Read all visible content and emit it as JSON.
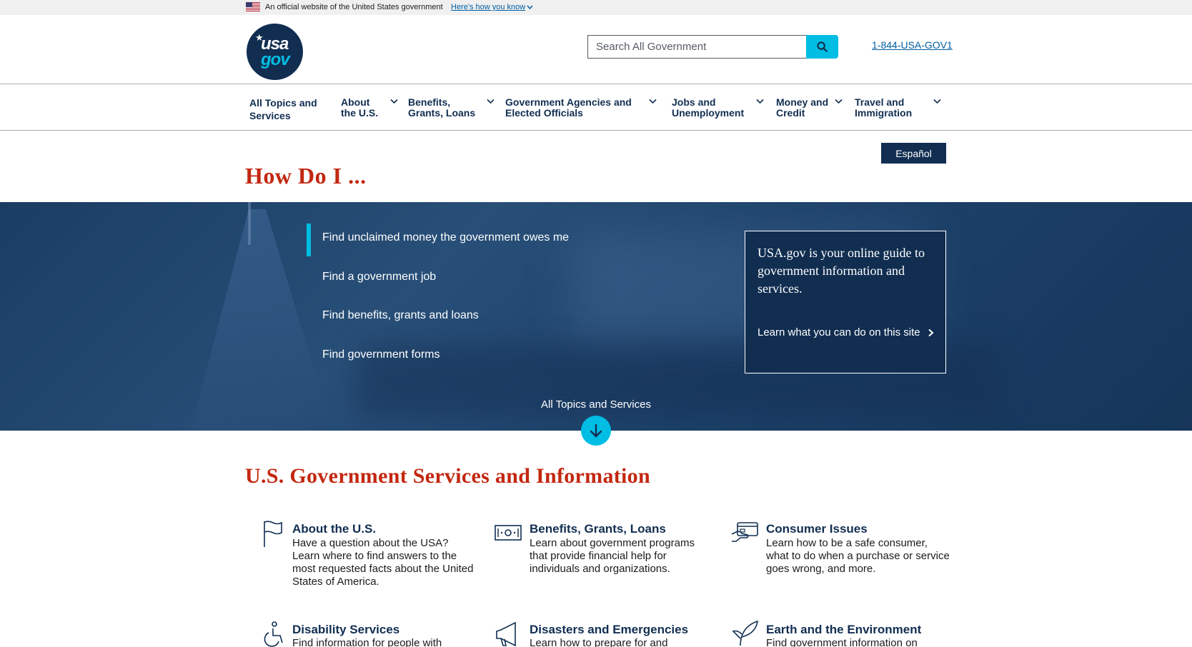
{
  "banner": {
    "official": "An official website of the United States government",
    "how_you_know": "Here's how you know"
  },
  "header": {
    "logo_top": "usa",
    "logo_bottom": "gov",
    "search_placeholder": "Search All Government",
    "phone": "1-844-USA-GOV1"
  },
  "nav": [
    {
      "line1": "All Topics and",
      "line2": "Services"
    },
    {
      "line1": "About",
      "line2": "the U.S."
    },
    {
      "line1": "Benefits,",
      "line2": "Grants, Loans"
    },
    {
      "line1": "Government Agencies and",
      "line2": "Elected Officials"
    },
    {
      "line1": "Jobs and",
      "line2": "Unemployment"
    },
    {
      "line1": "Money and",
      "line2": "Credit"
    },
    {
      "line1": "Travel and",
      "line2": "Immigration"
    }
  ],
  "language_button": "Español",
  "how_title": "How Do I ...",
  "quick_links": [
    "Find unclaimed money the government owes me",
    "Find a government job",
    "Find benefits, grants and loans",
    "Find government forms"
  ],
  "info_box": {
    "text": "USA.gov is your online guide to government information and services.",
    "learn": "Learn what you can do on this site"
  },
  "all_topics": "All Topics and Services",
  "services_title": "U.S. Government Services and Information",
  "cards": [
    {
      "icon": "flag-icon",
      "title": "About the U.S.",
      "desc": "Have a question about the USA? Learn where to find answers to the most requested facts about the United States of America."
    },
    {
      "icon": "money-icon",
      "title": "Benefits, Grants, Loans",
      "desc": "Learn about government programs that provide financial help for individuals and organizations."
    },
    {
      "icon": "credit-card-hand-icon",
      "title": "Consumer Issues",
      "desc": "Learn how to be a safe consumer, what to do when a purchase or service goes wrong, and more."
    },
    {
      "icon": "accessibility-icon",
      "title": "Disability Services",
      "desc": "Find information for people with"
    },
    {
      "icon": "megaphone-icon",
      "title": "Disasters and Emergencies",
      "desc": "Learn how to prepare for and"
    },
    {
      "icon": "leaf-icon",
      "title": "Earth and the Environment",
      "desc": "Find government information on"
    }
  ],
  "colors": {
    "navy": "#112e51",
    "cyan": "#00bde3",
    "red": "#c3270f",
    "link": "#005ea2"
  }
}
